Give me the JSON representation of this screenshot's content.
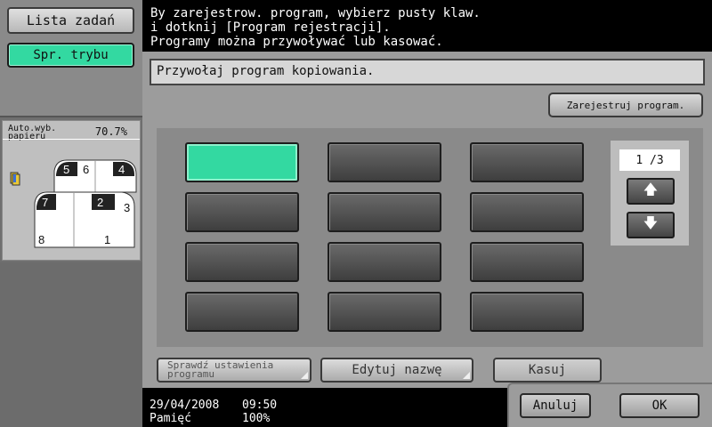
{
  "left_panel": {
    "job_list_label": "Lista zadań",
    "check_mode_label": "Spr. trybu",
    "paper_auto_label_line1": "Auto.wyb.",
    "paper_auto_label_line2": "papieru",
    "zoom": "70.7%",
    "page_numbers": [
      "5",
      "6",
      "4",
      "7",
      "2",
      "3",
      "8",
      "1"
    ]
  },
  "message": {
    "line1": "By zarejestrow. program, wybierz pusty klaw.",
    "line2": "i dotknij [Program rejestracji].",
    "line3": "Programy można przywoływać lub kasować."
  },
  "main": {
    "header": "Przywołaj program kopiowania.",
    "register_button": "Zarejestruj program.",
    "pager_text": "1 /3",
    "check_settings_line1": "Sprawdź ustawienia",
    "check_settings_line2": "programu",
    "edit_name_label": "Edytuj nazwę",
    "delete_label": "Kasuj"
  },
  "status": {
    "date": "29/04/2008",
    "time": "09:50",
    "memory_label": "Pamięć",
    "memory_value": "100%"
  },
  "actions": {
    "cancel_label": "Anuluj",
    "ok_label": "OK"
  },
  "colors": {
    "accent": "#33d9a1",
    "panel": "#9c9c9c"
  }
}
